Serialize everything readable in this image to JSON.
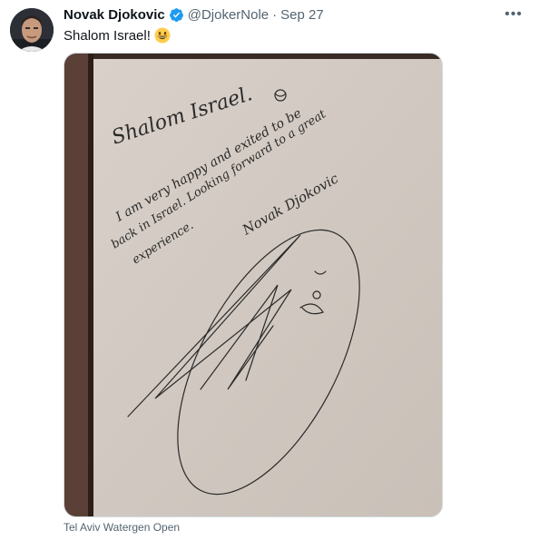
{
  "tweet": {
    "display_name": "Novak Djokovic",
    "verified_icon": "verified-badge-icon",
    "handle": "@DjokerNole",
    "separator": "·",
    "timestamp": "Sep 27",
    "text": "Shalom Israel!",
    "emoji": "grinning-face-emoji",
    "more_icon": "more-horizontal-icon",
    "more_label": "•••",
    "media_caption": "Tel Aviv Watergen Open",
    "accent_color": "#1d9bf0"
  },
  "photo": {
    "description_type": "handwritten guestbook page with signature",
    "handwriting": [
      "Shalom Israel.",
      "I am very happy and exited to be",
      "back in Israel. Looking forward to a great",
      "experience.",
      "Novak Djokovic"
    ]
  }
}
